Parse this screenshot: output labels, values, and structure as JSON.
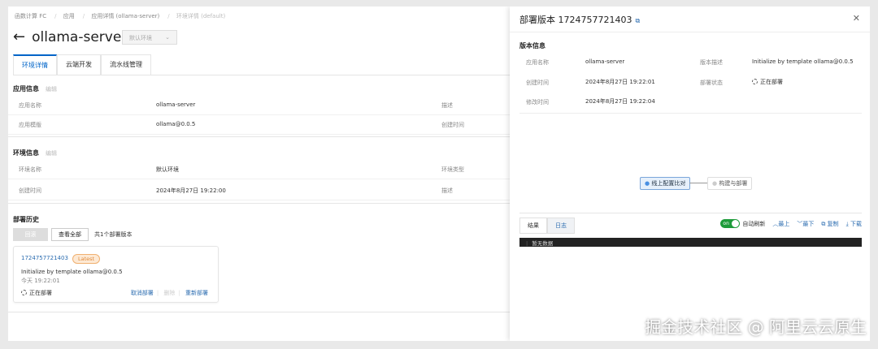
{
  "breadcrumb": [
    "函数计算 FC",
    "应用",
    "应用详情 (ollama-server)",
    "环境详情 (default)"
  ],
  "header": {
    "title": "ollama-server",
    "env_select": "默认环境"
  },
  "tabs": [
    "环境详情",
    "云端开发",
    "流水线管理"
  ],
  "app_info": {
    "title": "应用信息",
    "edit": "编辑",
    "rows": [
      {
        "label": "应用名称",
        "value": "ollama-server",
        "label2": "描述"
      },
      {
        "label": "应用模版",
        "value": "ollama@0.0.5",
        "label2": "创建时间"
      }
    ]
  },
  "env_info": {
    "title": "环境信息",
    "edit": "编辑",
    "rows": [
      {
        "label": "环境名称",
        "value": "默认环境",
        "label2": "环境类型"
      },
      {
        "label": "创建时间",
        "value": "2024年8月27日 19:22:00",
        "label2": "描述"
      }
    ]
  },
  "history": {
    "title": "部署历史",
    "rollback": "回滚",
    "view_all": "查看全部",
    "count": "共1个部署版本",
    "card": {
      "id": "1724757721403",
      "badge": "Latest",
      "desc": "Initialize by template ollama@0.0.5",
      "time": "今天 19:22:01",
      "status": "正在部署",
      "cancel": "取消部署",
      "delete": "删除",
      "redeploy": "重新部署"
    }
  },
  "panel": {
    "title": "部署版本 1724757721403",
    "section": "版本信息",
    "fields": {
      "app_name_label": "应用名称",
      "app_name": "ollama-server",
      "desc_label": "版本描述",
      "desc": "Initialize by template ollama@0.0.5",
      "created_label": "创建时间",
      "created": "2024年8月27日 19:22:01",
      "status_label": "部署状态",
      "status": "正在部署",
      "modified_label": "修改时间",
      "modified": "2024年8月27日 19:22:04"
    },
    "flow": [
      "线上配置比对",
      "构建与部署"
    ],
    "log_tabs": [
      "结果",
      "日志"
    ],
    "tools": {
      "toggle": "on",
      "auto_refresh": "自动刷新",
      "top": "最上",
      "bottom": "最下",
      "copy": "复制",
      "download": "下载"
    },
    "log_empty": "暂无数据"
  },
  "watermark": "掘金技术社区 @ 阿里云云原生"
}
